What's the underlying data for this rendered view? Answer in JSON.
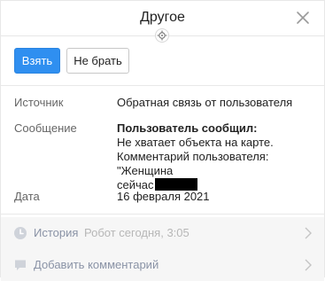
{
  "header": {
    "title": "Другое"
  },
  "actions": {
    "take_label": "Взять",
    "decline_label": "Не брать"
  },
  "fields": {
    "source": {
      "label": "Источник",
      "value": "Обратная связь от пользователя"
    },
    "message": {
      "label": "Сообщение",
      "title": "Пользователь сообщил:",
      "line1": "Не хватает объекта на карте.",
      "line2": "Комментарий пользователя: \"Женщина",
      "line3": "сейчас"
    },
    "date": {
      "label": "Дата",
      "value": "16 февраля 2021"
    }
  },
  "history": {
    "label": "История",
    "meta": "Робот сегодня, 3:05"
  },
  "comment": {
    "label": "Добавить комментарий"
  },
  "colors": {
    "primary": "#2f8ff0",
    "row_bg": "#f6f6f6",
    "link_gray": "#8a93a6"
  },
  "icons": [
    "close-icon",
    "target-icon",
    "clock-icon",
    "comment-icon",
    "chevron-right-icon"
  ]
}
